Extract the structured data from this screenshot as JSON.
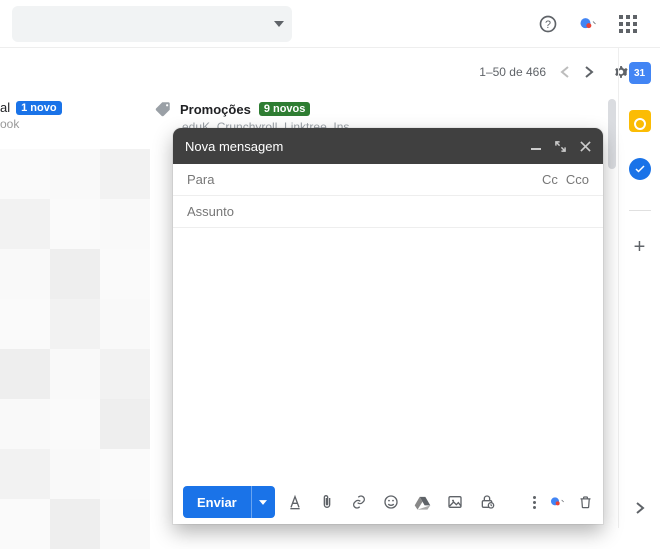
{
  "header": {
    "search_placeholder": ""
  },
  "toolbar": {
    "range_text": "1–50 de 466"
  },
  "tabs": {
    "social_suffix": "al",
    "social_badge": "1 novo",
    "social_sub": "ook",
    "promo_label": "Promoções",
    "promo_badge": "9 novos",
    "promo_sub": "eduK, Crunchyroll, Linktree, Ins…"
  },
  "compose": {
    "title": "Nova mensagem",
    "to_label": "Para",
    "cc_label": "Cc",
    "bcc_label": "Cco",
    "subject_label": "Assunto",
    "send_label": "Enviar"
  },
  "sidepanel": {
    "calendar_day": "31"
  }
}
